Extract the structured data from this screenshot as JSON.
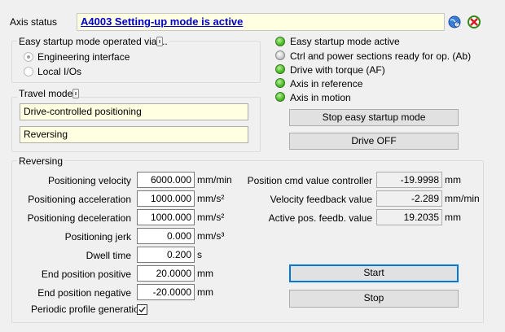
{
  "axis_status": {
    "label": "Axis status",
    "value": "A4003 Setting-up mode is active"
  },
  "startup_group": {
    "title": "Easy startup mode operated via ...",
    "options": [
      {
        "label": "Engineering interface",
        "selected": true
      },
      {
        "label": "Local I/Os",
        "selected": false
      }
    ]
  },
  "status_indicators": [
    {
      "label": "Easy startup mode active",
      "on": true
    },
    {
      "label": "Ctrl and power sections ready for op. (Ab)",
      "on": false
    },
    {
      "label": "Drive with torque (AF)",
      "on": true
    },
    {
      "label": "Axis in reference",
      "on": true
    },
    {
      "label": "Axis in motion",
      "on": true
    }
  ],
  "travel_mode": {
    "title": "Travel mode",
    "mode": "Drive-controlled positioning",
    "submode": "Reversing"
  },
  "buttons": {
    "stop_easy": "Stop easy startup mode",
    "drive_off": "Drive OFF",
    "start": "Start",
    "stop": "Stop"
  },
  "reversing": {
    "title": "Reversing",
    "params": [
      {
        "label": "Positioning velocity",
        "value": "6000.000",
        "unit": "mm/min"
      },
      {
        "label": "Positioning acceleration",
        "value": "1000.000",
        "unit": "mm/s²"
      },
      {
        "label": "Positioning deceleration",
        "value": "1000.000",
        "unit": "mm/s²"
      },
      {
        "label": "Positioning jerk",
        "value": "0.000",
        "unit": "mm/s³"
      },
      {
        "label": "Dwell time",
        "value": "0.200",
        "unit": "s"
      },
      {
        "label": "End position positive",
        "value": "20.0000",
        "unit": "mm"
      },
      {
        "label": "End position negative",
        "value": "-20.0000",
        "unit": "mm"
      }
    ],
    "readouts": [
      {
        "label": "Position cmd value controller",
        "value": "-19.9998",
        "unit": "mm"
      },
      {
        "label": "Velocity feedback value",
        "value": "-2.289",
        "unit": "mm/min"
      },
      {
        "label": "Active pos. feedb. value",
        "value": "19.2035",
        "unit": "mm"
      }
    ],
    "periodic": {
      "label": "Periodic profile generation",
      "checked": true
    }
  },
  "colors": {
    "field_yellow": "#ffffe1",
    "link_blue": "#0000cc",
    "led_green": "#4fc12a"
  },
  "icons": [
    "help-globe-icon",
    "close-error-icon",
    "lock-icon"
  ]
}
